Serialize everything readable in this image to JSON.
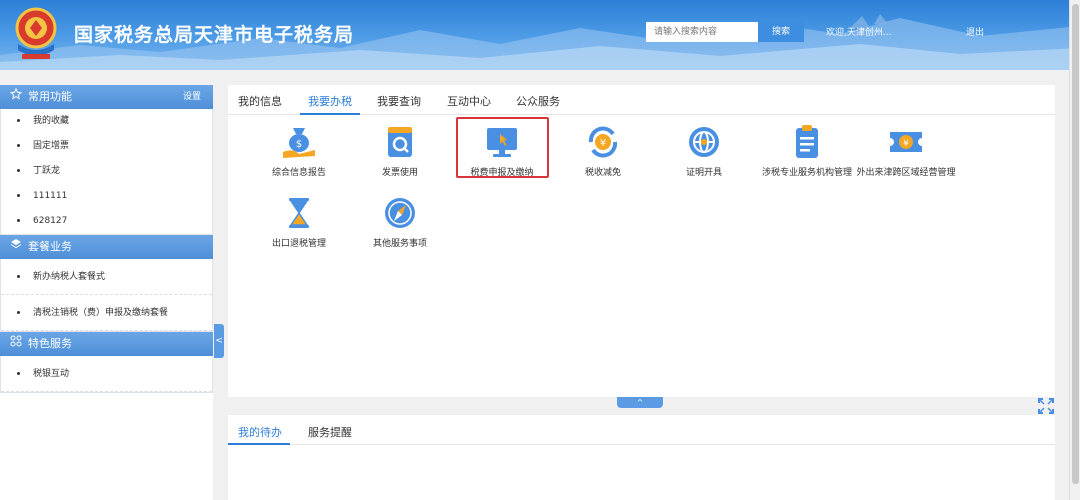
{
  "header": {
    "title": "国家税务总局天津市电子税务局",
    "emblem_icon": "tax-emblem-icon",
    "search_placeholder": "请输入搜索内容",
    "search_button": "搜索",
    "welcome": "欢迎,天津创州...",
    "logout": "退出"
  },
  "sidebar": {
    "common": {
      "title": "常用功能",
      "icon": "star-icon",
      "settings": "设置",
      "items": [
        "我的收藏",
        "固定增票",
        "丁跃龙",
        "111111",
        "628127"
      ]
    },
    "packages": {
      "title": "套餐业务",
      "icon": "layers-icon",
      "items": [
        "新办纳税人套餐式",
        "清税注销税（费）申报及缴纳套餐"
      ]
    },
    "special": {
      "title": "特色服务",
      "icon": "grid-icon",
      "items": [
        "税银互动"
      ]
    },
    "collapse_arrow": "<"
  },
  "main": {
    "tabs": [
      "我的信息",
      "我要办税",
      "我要查询",
      "互动中心",
      "公众服务"
    ],
    "active_tab": "我要办税",
    "items": [
      {
        "label": "综合信息报告",
        "icon": "money-bag-icon"
      },
      {
        "label": "发票使用",
        "icon": "invoice-search-icon"
      },
      {
        "label": "税费申报及缴纳",
        "icon": "monitor-cursor-icon"
      },
      {
        "label": "税收减免",
        "icon": "yuan-refresh-icon"
      },
      {
        "label": "证明开具",
        "icon": "globe-certificate-icon"
      },
      {
        "label": "涉税专业服务机构管理",
        "icon": "clipboard-icon"
      },
      {
        "label": "外出来津跨区域经营管理",
        "icon": "ticket-yuan-icon"
      },
      {
        "label": "出口退税管理",
        "icon": "hourglass-icon"
      },
      {
        "label": "其他服务事项",
        "icon": "compass-icon"
      }
    ],
    "expand_arrow": "^"
  },
  "bottom": {
    "tabs": [
      "我的待办",
      "服务提醒"
    ],
    "active_tab": "我的待办"
  },
  "colors": {
    "accent": "#2d7fd6",
    "header": "#4b9ae6",
    "highlight": "#d9343a",
    "icon_blue": "#4a90e2",
    "icon_orange": "#f5a623"
  }
}
